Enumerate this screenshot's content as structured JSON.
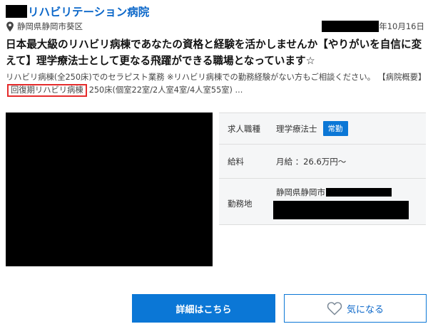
{
  "header": {
    "hospital_name": "リハビリテーション病院",
    "location": "静岡県静岡市葵区",
    "date": "年10月16日"
  },
  "headline": "日本最大級のリハビリ病棟であなたの資格と経験を活かしませんか【やりがいを自信に変えて】理学療法士として更なる飛躍ができる職場となっています☆",
  "description": {
    "before": "リハビリ病棟(全250床)でのセラピスト業務 ※リハビリ病棟での勤務経験がない方もご相談ください。 【病院概要】",
    "highlight": "回復期リハビリ病棟",
    "after": "250床(個室22室/2人室4室/4人室55室) ..."
  },
  "info": {
    "job_label": "求人職種",
    "job_value": "理学療法士",
    "employment_badge": "常勤",
    "salary_label": "給料",
    "salary_value": "月給 ：26.6万円～",
    "work_label": "勤務地",
    "work_value": "静岡県静岡市"
  },
  "buttons": {
    "detail_label": "詳細はこちら",
    "favorite_label": "気になる"
  },
  "icons": {
    "location": "map-pin-icon",
    "favorite": "heart-icon"
  },
  "colors": {
    "link_blue": "#0b67c9",
    "button_blue": "#0b77d6",
    "highlight_red": "#e52b2b"
  }
}
